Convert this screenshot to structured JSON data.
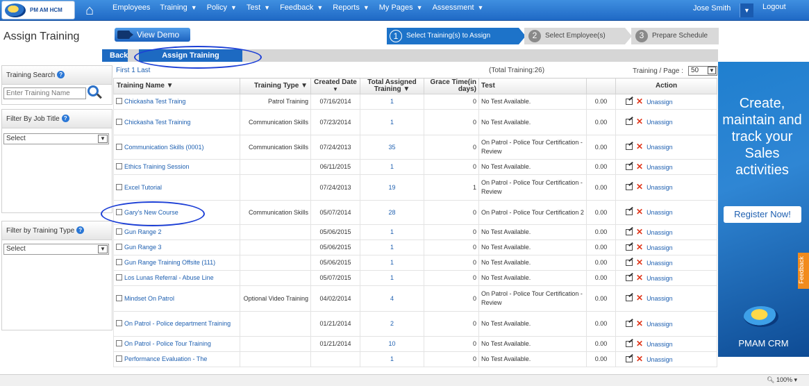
{
  "brand": {
    "logo_text": "PM AM HCM"
  },
  "nav": {
    "items": [
      {
        "label": "Employees",
        "caret": false
      },
      {
        "label": "Training",
        "caret": true
      },
      {
        "label": "Policy",
        "caret": true
      },
      {
        "label": "Test",
        "caret": true
      },
      {
        "label": "Feedback",
        "caret": true
      },
      {
        "label": "Reports",
        "caret": true
      },
      {
        "label": "My Pages",
        "caret": true
      },
      {
        "label": "Assessment",
        "caret": true
      }
    ],
    "user": "Jose Smith",
    "logout": "Logout"
  },
  "page": {
    "title": "Assign Training",
    "demo_button": "View Demo",
    "wizard": [
      {
        "num": "1",
        "label": "Select Training(s) to Assign",
        "active": true
      },
      {
        "num": "2",
        "label": "Select Employee(s)",
        "active": false
      },
      {
        "num": "3",
        "label": "Prepare Schedule",
        "active": false
      }
    ],
    "tabs": {
      "back": "Back",
      "assign": "Assign Training"
    }
  },
  "sidebar": {
    "search_title": "Training Search",
    "search_placeholder": "Enter Training Name",
    "job_title_label": "Filter By Job Title",
    "job_title_value": "Select",
    "training_type_label": "Filter by Training Type",
    "training_type_value": "Select"
  },
  "grid": {
    "pager": "First  1  Last",
    "total": "(Total Training:26)",
    "per_page_label": "Training / Page :",
    "per_page_value": "50",
    "columns": [
      "Training Name",
      "Training Type",
      "Created Date",
      "Total Assigned Training",
      "Grace Time(in days)",
      "Test",
      "",
      "Action"
    ],
    "rows": [
      {
        "name": "Chickasha Test Traing",
        "type": "Patrol Training",
        "date": "07/16/2014",
        "assigned": "1",
        "grace": "0",
        "test": "No Test Available.",
        "score": "0.00"
      },
      {
        "name": "Chickasha Test Training",
        "type": "Communication Skills",
        "date": "07/23/2014",
        "assigned": "1",
        "grace": "0",
        "test": "No Test Available.",
        "score": "0.00"
      },
      {
        "name": "Communication Skills (0001)",
        "type": "Communication Skills",
        "date": "07/24/2013",
        "assigned": "35",
        "grace": "0",
        "test": "On Patrol - Police Tour Certification - Review",
        "score": "0.00"
      },
      {
        "name": "Ethics Training Session",
        "type": "",
        "date": "06/11/2015",
        "assigned": "1",
        "grace": "0",
        "test": "No Test Available.",
        "score": "0.00"
      },
      {
        "name": "Excel Tutorial",
        "type": "",
        "date": "07/24/2013",
        "assigned": "19",
        "grace": "1",
        "test": "On Patrol - Police Tour Certification - Review",
        "score": "0.00"
      },
      {
        "name": "Gary's New Course",
        "type": "Communication Skills",
        "date": "05/07/2014",
        "assigned": "28",
        "grace": "0",
        "test": "On Patrol - Police Tour Certification 2",
        "score": "0.00"
      },
      {
        "name": "Gun Range 2",
        "type": "",
        "date": "05/06/2015",
        "assigned": "1",
        "grace": "0",
        "test": "No Test Available.",
        "score": "0.00"
      },
      {
        "name": "Gun Range 3",
        "type": "",
        "date": "05/06/2015",
        "assigned": "1",
        "grace": "0",
        "test": "No Test Available.",
        "score": "0.00"
      },
      {
        "name": "Gun Range Training Offsite (111)",
        "type": "",
        "date": "05/06/2015",
        "assigned": "1",
        "grace": "0",
        "test": "No Test Available.",
        "score": "0.00"
      },
      {
        "name": "Los Lunas Referral - Abuse Line",
        "type": "",
        "date": "05/07/2015",
        "assigned": "1",
        "grace": "0",
        "test": "No Test Available.",
        "score": "0.00"
      },
      {
        "name": "Mindset On Patrol",
        "type": "Optional Video Training",
        "date": "04/02/2014",
        "assigned": "4",
        "grace": "0",
        "test": "On Patrol - Police Tour Certification - Review",
        "score": "0.00"
      },
      {
        "name": "On Patrol - Police department Training",
        "type": "",
        "date": "01/21/2014",
        "assigned": "2",
        "grace": "0",
        "test": "No Test Available.",
        "score": "0.00"
      },
      {
        "name": "On Patrol - Police Tour Training",
        "type": "",
        "date": "01/21/2014",
        "assigned": "10",
        "grace": "0",
        "test": "No Test Available.",
        "score": "0.00"
      },
      {
        "name": "Performance Evaluation - The",
        "type": "",
        "date": "",
        "assigned": "1",
        "grace": "0",
        "test": "No Test Available.",
        "score": "0.00"
      }
    ],
    "unassign_label": "Unassign"
  },
  "ad": {
    "headline": "Create, maintain and track your Sales activities",
    "cta": "Register Now!",
    "product": "PMAM CRM"
  },
  "feedback_tab": "Feedback",
  "zoom": "100%"
}
